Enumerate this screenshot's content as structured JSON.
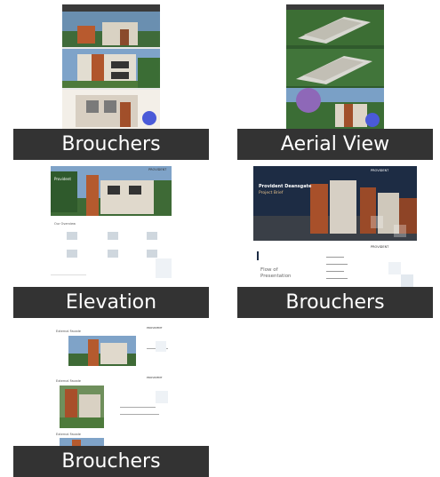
{
  "tiles": [
    {
      "label": "Brouchers"
    },
    {
      "label": "Aerial View"
    },
    {
      "label": "Elevation"
    },
    {
      "label": "Brouchers"
    },
    {
      "label": "Brouchers"
    }
  ],
  "brochure_brand": "PROVIDENT",
  "presentation": {
    "title_line1": "Provident Deansgate",
    "title_line2": "Project Brief",
    "flow_title_line1": "Flow of",
    "flow_title_line2": "Presentation"
  },
  "elevation_page": {
    "section_label": "Our Overview"
  },
  "exterior_page": {
    "heading": "External Facade"
  },
  "colors": {
    "caption_bg": "#333333",
    "caption_text": "#ffffff",
    "play_badge": "#4a5ad8"
  }
}
